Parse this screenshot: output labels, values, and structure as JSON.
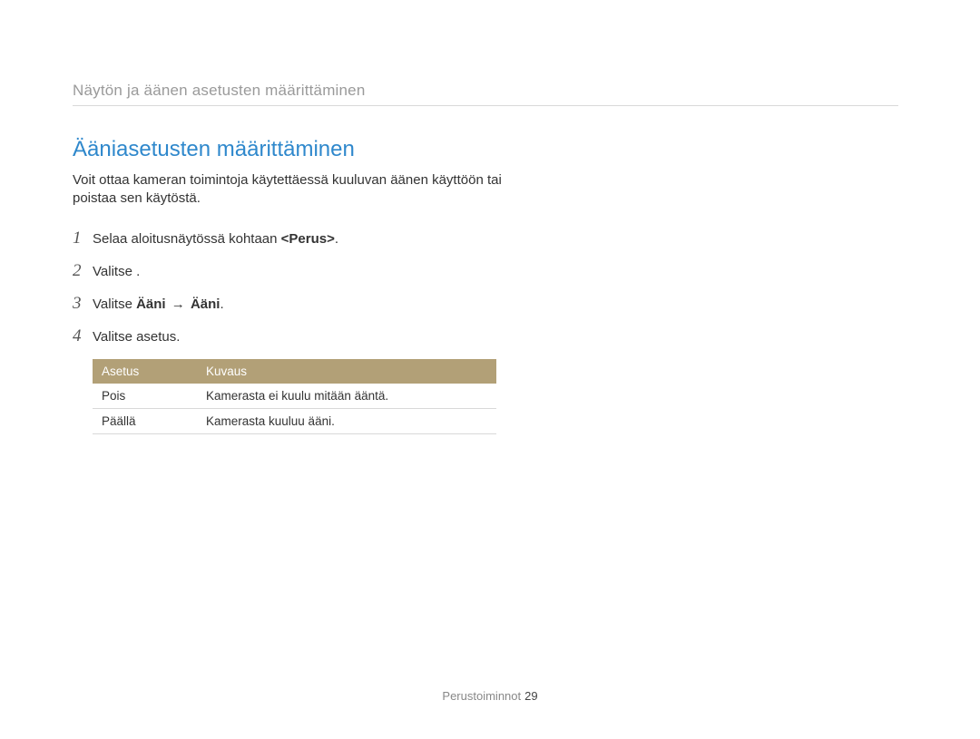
{
  "breadcrumb": "Näytön ja äänen asetusten määrittäminen",
  "section_title": "Ääniasetusten määrittäminen",
  "intro": "Voit ottaa kameran toimintoja käytettäessä kuuluvan äänen käyttöön tai poistaa sen käytöstä.",
  "steps": {
    "s1": {
      "num": "1",
      "prefix": "Selaa aloitusnäytössä kohtaan ",
      "bold": "<Perus>",
      "suffix": "."
    },
    "s2": {
      "num": "2",
      "text": "Valitse      ."
    },
    "s3": {
      "num": "3",
      "prefix": "Valitse ",
      "bold1": "Ääni",
      "arrow": "→",
      "bold2": "Ääni",
      "suffix": "."
    },
    "s4": {
      "num": "4",
      "text": "Valitse asetus."
    }
  },
  "table": {
    "headers": {
      "col1": "Asetus",
      "col2": "Kuvaus"
    },
    "rows": [
      {
        "c1": "Pois",
        "c2": "Kamerasta ei kuulu mitään ääntä."
      },
      {
        "c1": "Päällä",
        "c2": "Kamerasta kuuluu ääni."
      }
    ]
  },
  "footer": {
    "section": "Perustoiminnot",
    "page": "29"
  }
}
